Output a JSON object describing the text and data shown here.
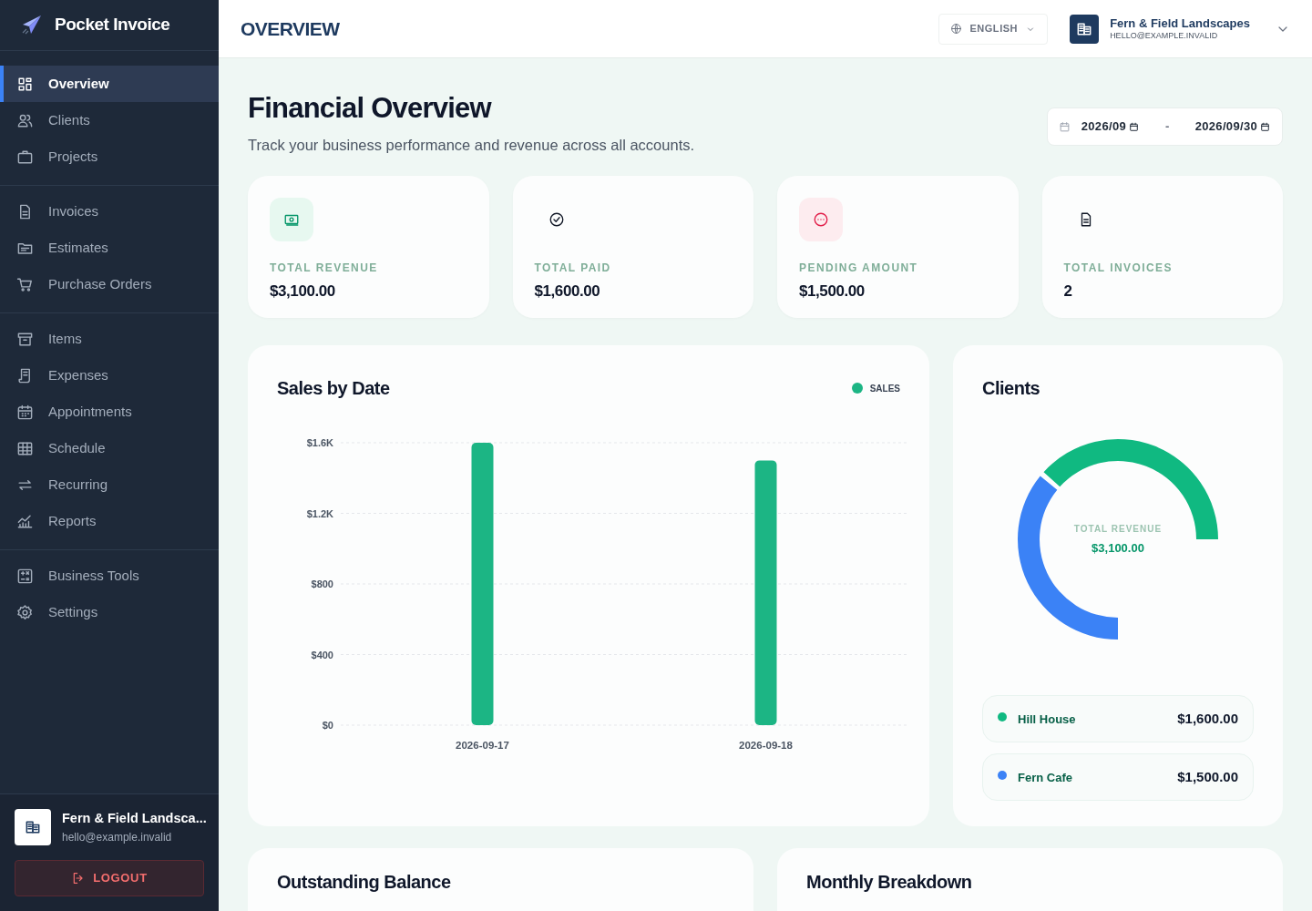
{
  "app": {
    "name": "Pocket Invoice"
  },
  "sidebar": {
    "sections": [
      {
        "items": [
          {
            "label": "Overview",
            "selected": true
          },
          {
            "label": "Clients",
            "selected": false
          },
          {
            "label": "Projects",
            "selected": false
          }
        ]
      },
      {
        "items": [
          {
            "label": "Invoices",
            "selected": false
          },
          {
            "label": "Estimates",
            "selected": false
          },
          {
            "label": "Purchase Orders",
            "selected": false
          }
        ]
      },
      {
        "items": [
          {
            "label": "Items",
            "selected": false
          },
          {
            "label": "Expenses",
            "selected": false
          },
          {
            "label": "Appointments",
            "selected": false
          },
          {
            "label": "Schedule",
            "selected": false
          },
          {
            "label": "Recurring",
            "selected": false
          },
          {
            "label": "Reports",
            "selected": false
          }
        ]
      },
      {
        "items": [
          {
            "label": "Business Tools",
            "selected": false
          },
          {
            "label": "Settings",
            "selected": false
          }
        ]
      }
    ],
    "account": {
      "name": "Fern & Field Landsca...",
      "email": "hello@example.invalid"
    },
    "logout": "LOGOUT"
  },
  "header": {
    "title": "OVERVIEW",
    "language": "ENGLISH",
    "account": {
      "name": "Fern & Field Landscapes",
      "email": "HELLO@EXAMPLE.INVALID"
    }
  },
  "page": {
    "title": "Financial Overview",
    "subtitle": "Track your business performance and revenue across all accounts.",
    "date_from": "2026/09",
    "date_separator": "-",
    "date_to": "2026/09/30"
  },
  "stats": [
    {
      "kind": "revenue",
      "label": "TOTAL REVENUE",
      "value": "$3,100.00"
    },
    {
      "kind": "paid",
      "label": "TOTAL PAID",
      "value": "$1,600.00"
    },
    {
      "kind": "pending",
      "label": "PENDING AMOUNT",
      "value": "$1,500.00"
    },
    {
      "kind": "invoices",
      "label": "TOTAL INVOICES",
      "value": "2"
    }
  ],
  "sales_card": {
    "title": "Sales by Date",
    "chart_data": {
      "type": "bar",
      "categories": [
        "2026-09-17",
        "2026-09-18"
      ],
      "series": [
        {
          "name": "SALES",
          "color": "#1cb584",
          "values": [
            1600,
            1500
          ]
        }
      ],
      "grid": true,
      "ylim": [
        0,
        1600
      ],
      "yticks": [
        {
          "value": 0,
          "label": "$0"
        },
        {
          "value": 400,
          "label": "$400"
        },
        {
          "value": 800,
          "label": "$800"
        },
        {
          "value": 1200,
          "label": "$1.2K"
        },
        {
          "value": 1600,
          "label": "$1.6K"
        }
      ]
    }
  },
  "clients_card": {
    "title": "Clients",
    "center_label": "TOTAL REVENUE",
    "center_value": "$3,100.00",
    "chart_data": {
      "type": "donut",
      "categories": [
        "Hill House",
        "Fern Cafe"
      ],
      "values": [
        51.6,
        48.4
      ]
    },
    "clients": [
      {
        "amount": "$1,600.00",
        "color": "#10b981"
      },
      {
        "amount": "$1,500.00",
        "color": "#3b82f6"
      }
    ]
  },
  "bottom_cards": [
    {
      "title": "Outstanding Balance"
    },
    {
      "title": "Monthly Breakdown"
    }
  ]
}
